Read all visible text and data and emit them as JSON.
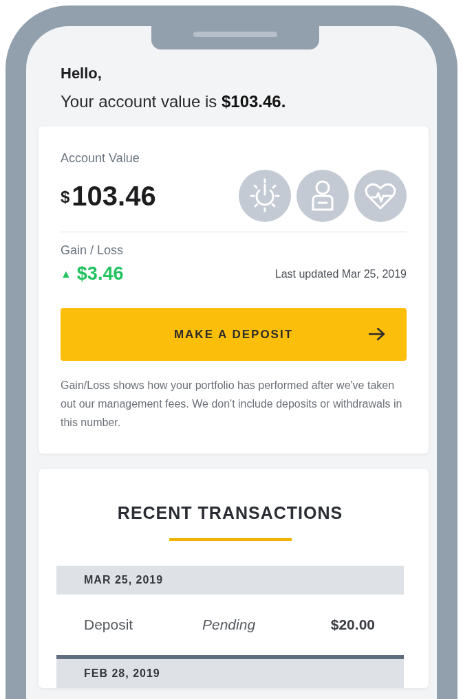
{
  "greeting": {
    "title": "Hello,",
    "message": "Your account value is **$103.46.**"
  },
  "account": {
    "label": "Account Value",
    "currency": "$",
    "value": "103.46"
  },
  "gain": {
    "label": "Gain / Loss",
    "arrow": "▲",
    "value": "$3.46",
    "last_updated": "Last updated Mar 25, 2019"
  },
  "deposit_button": {
    "label": "MAKE A DEPOSIT"
  },
  "note": "Gain/Loss shows how your portfolio has performed after we've taken out our management fees. We don't include deposits or withdrawals in this number.",
  "transactions": {
    "title": "RECENT TRANSACTIONS",
    "groups": [
      {
        "date": "MAR 25, 2019",
        "items": [
          {
            "type": "Deposit",
            "status": "Pending",
            "amount": "$20.00"
          }
        ]
      },
      {
        "date": "FEB 28, 2019"
      }
    ]
  }
}
